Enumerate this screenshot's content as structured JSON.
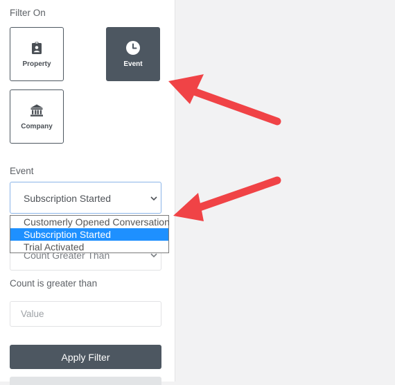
{
  "filter_on": {
    "label": "Filter On",
    "tiles": [
      {
        "label": "Property",
        "icon": "badge-icon",
        "active": false
      },
      {
        "label": "Event",
        "icon": "clock-icon",
        "active": true
      },
      {
        "label": "Company",
        "icon": "bank-icon",
        "active": false
      }
    ]
  },
  "event": {
    "label": "Event",
    "selected_value": "Subscription Started",
    "options": [
      "Customerly Opened Conversation",
      "Subscription Started",
      "Trial Activated"
    ],
    "selected_index": 1
  },
  "condition": {
    "selected_value": "Count Greater Than"
  },
  "count": {
    "label": "Count is greater than",
    "placeholder": "Value"
  },
  "actions": {
    "apply_label": "Apply Filter"
  },
  "colors": {
    "accent": "#4d5761",
    "focus_border": "#8ab4e8",
    "highlight": "#1e90ff",
    "annotation_arrow": "#f04346"
  }
}
